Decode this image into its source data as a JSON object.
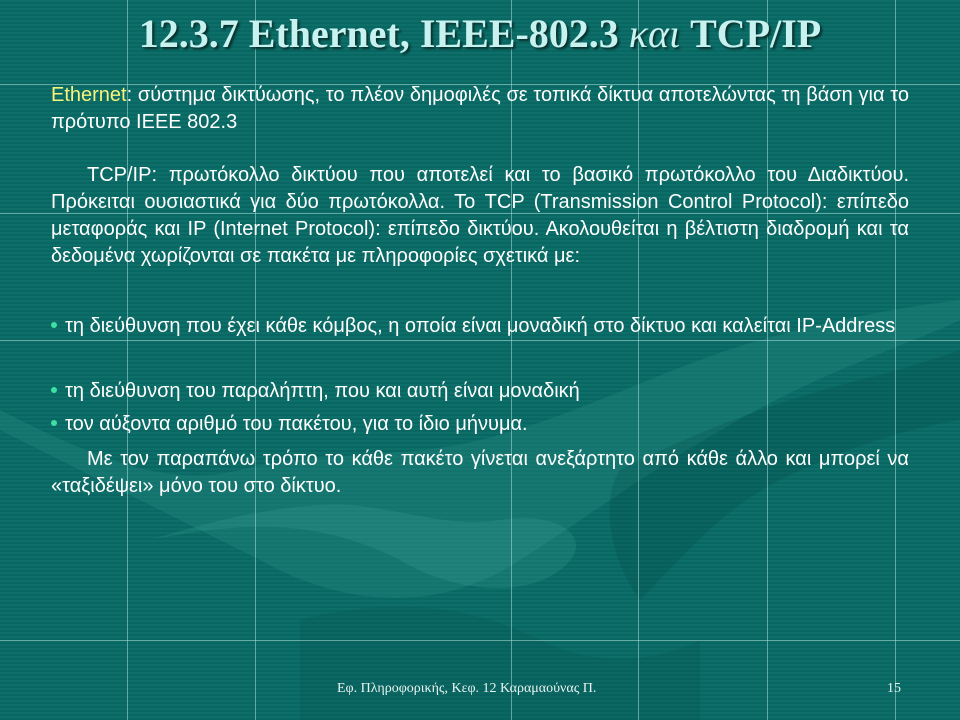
{
  "slide": {
    "title_prefix": "12.3.7 Ethernet, IEEE-802.3 ",
    "title_kai": "και",
    "title_suffix": " TCP/IP",
    "ethernet_term": "Ethernet",
    "ethernet_def": ": σύστημα δικτύωσης, το πλέον δημοφιλές σε τοπικά δίκτυα αποτελώντας τη βάση για το πρότυπο IEEE 802.3",
    "tcpip_paragraph": "TCP/IP: πρωτόκολλο δικτύου που αποτελεί και το βασικό πρωτόκολλο του Διαδικτύου. Πρόκειται ουσιαστικά για δύο πρωτόκολλα. Το TCP (Transmission Control Protocol): επίπεδο μεταφοράς και IP (Internet Protocol): επίπεδο δικτύου. Ακολουθείται η βέλτιστη διαδρομή και τα δεδομένα χωρίζονται σε πακέτα με πληροφορίες σχετικά με:",
    "bullets": [
      "τη διεύθυνση που έχει κάθε κόμβος, η οποία είναι μοναδική στο δίκτυο και καλείται IP-Address",
      "τη διεύθυνση του παραλήπτη, που και αυτή είναι μοναδική",
      "τον αύξοντα αριθμό του πακέτου, για το ίδιο μήνυμα."
    ],
    "closing_paragraph": "Με τον παραπάνω τρόπο το κάθε πακέτο γίνεται ανεξάρτητο από κάθε άλλο και μπορεί να «ταξιδέψει» μόνο του στο δίκτυο."
  },
  "footer": {
    "course": "Εφ. Πληροφορικής, Κεφ. 12 Καραμαούνας Π.",
    "page_number": "15"
  },
  "colors": {
    "background": "#086a65",
    "title": "#c8f2f0",
    "highlight": "#f6f47a",
    "bullet": "#3de0a2"
  }
}
